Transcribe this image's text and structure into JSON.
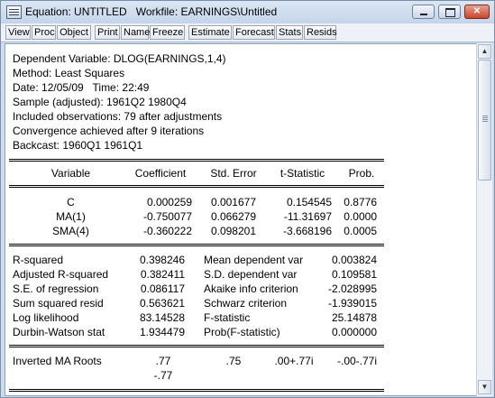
{
  "window": {
    "title": "Equation: UNTITLED   Workfile: EARNINGS\\Untitled"
  },
  "toolbar": {
    "buttons": [
      "View",
      "Proc",
      "Object",
      "Print",
      "Name",
      "Freeze",
      "Estimate",
      "Forecast",
      "Stats",
      "Resids"
    ]
  },
  "header_lines": [
    "Dependent Variable: DLOG(EARNINGS,1,4)",
    "Method: Least Squares",
    "Date: 12/05/09   Time: 22:49",
    "Sample (adjusted): 1961Q2 1980Q4",
    "Included observations: 79 after adjustments",
    "Convergence achieved after 9 iterations",
    "Backcast: 1960Q1 1961Q1"
  ],
  "coef_table": {
    "headers": [
      "Variable",
      "Coefficient",
      "Std. Error",
      "t-Statistic",
      "Prob."
    ],
    "rows": [
      [
        "C",
        "0.000259",
        "0.001677",
        "0.154545",
        "0.8776"
      ],
      [
        "MA(1)",
        "-0.750077",
        "0.066279",
        "-11.31697",
        "0.0000"
      ],
      [
        "SMA(4)",
        "-0.360222",
        "0.098201",
        "-3.668196",
        "0.0005"
      ]
    ]
  },
  "stats": [
    [
      "R-squared",
      "0.398246",
      "Mean dependent var",
      "0.003824"
    ],
    [
      "Adjusted R-squared",
      "0.382411",
      "S.D. dependent var",
      "0.109581"
    ],
    [
      "S.E. of regression",
      "0.086117",
      "Akaike info criterion",
      "-2.028995"
    ],
    [
      "Sum squared resid",
      "0.563621",
      "Schwarz criterion",
      "-1.939015"
    ],
    [
      "Log likelihood",
      "83.14528",
      "F-statistic",
      "25.14878"
    ],
    [
      "Durbin-Watson stat",
      "1.934479",
      "Prob(F-statistic)",
      "0.000000"
    ]
  ],
  "roots": {
    "label": "Inverted MA Roots",
    "row1": [
      ".77",
      ".75",
      ".00+.77i",
      "-.00-.77i"
    ],
    "row2": "-.77"
  }
}
